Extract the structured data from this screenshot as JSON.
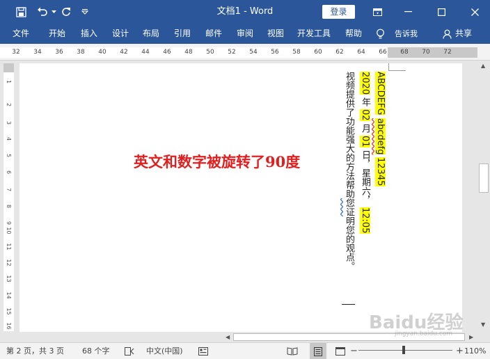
{
  "window": {
    "title": "文档1 - Word",
    "login_label": "登录"
  },
  "ribbon": {
    "tabs": [
      "文件",
      "开始",
      "插入",
      "设计",
      "布局",
      "引用",
      "邮件",
      "审阅",
      "视图",
      "开发工具",
      "帮助"
    ],
    "tell_me": "告诉我",
    "share": "共享"
  },
  "ruler": {
    "numbers": [
      "32",
      "34",
      "36",
      "38",
      "40",
      "42",
      "44",
      "46",
      "48",
      "50",
      "52",
      "54",
      "56",
      "58",
      "60",
      "62",
      "64",
      "66",
      "68",
      "70",
      "72"
    ],
    "vnumbers": [
      "1",
      "2",
      "3",
      "4",
      "5",
      "6",
      "7",
      "8",
      "9",
      "10",
      "11",
      "12",
      "13",
      "14",
      "15",
      "16"
    ]
  },
  "document": {
    "annotation": "英文和数字被旋转了90度",
    "col1": {
      "a": "ABCDEFG",
      "b": "abcdefg",
      "c": "12345"
    },
    "col2": {
      "year": "2020",
      "nian": "年",
      "month": "02",
      "yue": "月",
      "day": "01",
      "ri": "日，星期六，",
      "time": "12:05"
    },
    "col3": {
      "part1": "视频提供了功能强大的方法帮助",
      "part2": "您证",
      "part3": "明您的观点。"
    }
  },
  "statusbar": {
    "page": "第 2 页，共 3 页",
    "words": "68 个字",
    "language": "中文(中国)",
    "zoom": "110%"
  },
  "watermark": {
    "text": "Baidu经验",
    "sub": "jingyan.baidu.com"
  },
  "colors": {
    "brand": "#2b579a",
    "highlight": "#ffff00",
    "annotation": "#e02020"
  }
}
